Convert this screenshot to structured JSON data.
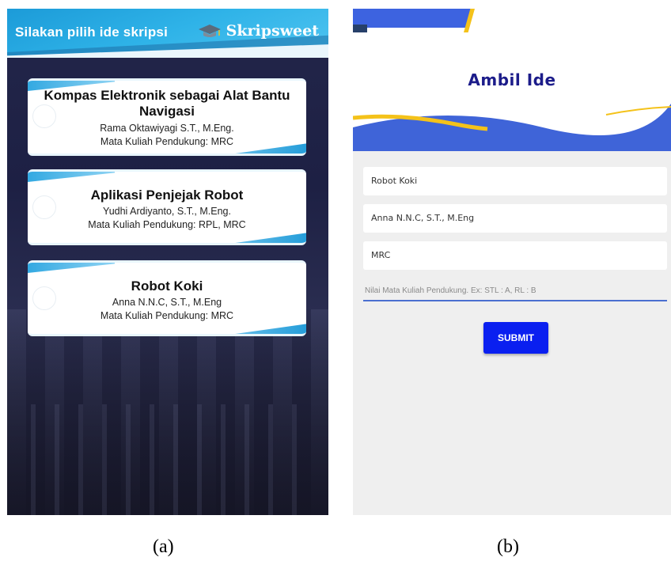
{
  "panel_a": {
    "header_title": "Silakan pilih ide skripsi",
    "brand_name": "Skripsweet",
    "brand_icon": "graduation-cap-icon",
    "ideas": [
      {
        "title": "Kompas Elektronik sebagai Alat Bantu Navigasi",
        "supervisor": "Rama Oktawiyagi S.T., M.Eng.",
        "course": "Mata Kuliah Pendukung: MRC"
      },
      {
        "title": "Aplikasi Penjejak Robot",
        "supervisor": "Yudhi Ardiyanto, S.T., M.Eng.",
        "course": "Mata Kuliah Pendukung: RPL, MRC"
      },
      {
        "title": "Robot Koki",
        "supervisor": "Anna N.N.C, S.T., M.Eng",
        "course": "Mata Kuliah Pendukung: MRC"
      }
    ]
  },
  "panel_b": {
    "title": "Ambil Ide",
    "fields": {
      "idea_title": "Robot Koki",
      "supervisor": "Anna N.N.C, S.T., M.Eng",
      "course": "MRC"
    },
    "grade_placeholder": "Nilai Mata Kuliah Pendukung. Ex: STL : A, RL : B",
    "submit_label": "SUBMIT"
  },
  "captions": {
    "a": "(a)",
    "b": "(b)"
  },
  "colors": {
    "header_blue": "#2fb3e8",
    "submit_blue": "#0a1ff0",
    "title_navy": "#1c1c8a",
    "accent_yellow": "#f4c21a"
  }
}
